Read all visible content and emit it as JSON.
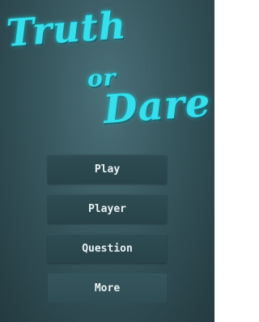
{
  "title": {
    "line1": "Truth",
    "line2": "or",
    "line3": "Dare"
  },
  "menu": {
    "play_label": "Play",
    "player_label": "Player",
    "question_label": "Question",
    "more_label": "More"
  },
  "colors": {
    "title_neon": "#35e0ec",
    "button_bg": "#2e4c53",
    "button_text": "#e9f1f2"
  }
}
